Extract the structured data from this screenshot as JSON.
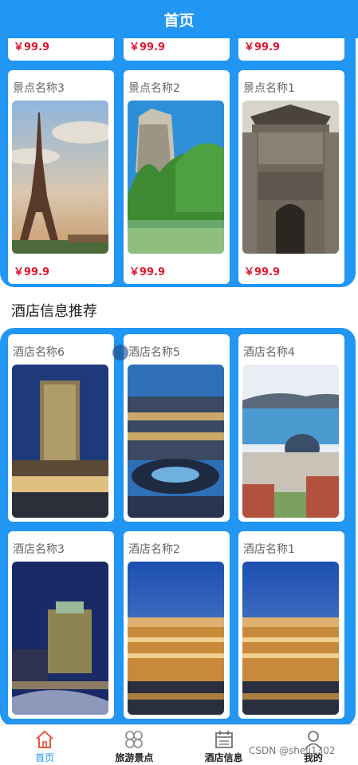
{
  "header": {
    "title": "首页"
  },
  "scenic": {
    "partial_prices": [
      "￥99.9",
      "￥99.9",
      "￥99.9"
    ],
    "cards": [
      {
        "name": "景点名称3",
        "price": "￥99.9",
        "image": "eiffel-tower"
      },
      {
        "name": "景点名称2",
        "price": "￥99.9",
        "image": "karst-mountain-river"
      },
      {
        "name": "景点名称1",
        "price": "￥99.9",
        "image": "ancient-gate"
      }
    ]
  },
  "hotels": {
    "section_title": "酒店信息推荐",
    "cards": [
      {
        "name": "酒店名称6",
        "image": "tower-hotel-night"
      },
      {
        "name": "酒店名称5",
        "image": "resort-fountain"
      },
      {
        "name": "酒店名称4",
        "image": "dome-building-bay"
      },
      {
        "name": "酒店名称3",
        "image": "city-night-hotel"
      },
      {
        "name": "酒店名称2",
        "image": "casino-hotel"
      },
      {
        "name": "酒店名称1",
        "image": "casino-hotel"
      }
    ]
  },
  "tabbar": {
    "items": [
      {
        "label": "首页",
        "icon": "home-icon",
        "active": true
      },
      {
        "label": "旅游景点",
        "icon": "clover-icon",
        "active": false
      },
      {
        "label": "酒店信息",
        "icon": "calendar-icon",
        "active": false
      },
      {
        "label": "我的",
        "icon": "user-icon",
        "active": false
      }
    ]
  },
  "watermark": "CSDN @shejj1302",
  "colors": {
    "primary": "#2196f3",
    "price": "#e0182f"
  }
}
